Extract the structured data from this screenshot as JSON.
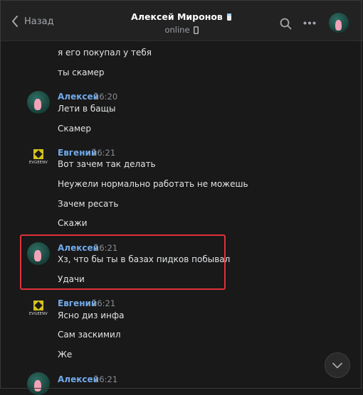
{
  "header": {
    "back_label": "Назад",
    "contact_name": "Алексей Миронов",
    "status": "online"
  },
  "messages": [
    {
      "text": "я его покупал у тебя"
    },
    {
      "text": "ты скамер"
    },
    {
      "author": "Алексей",
      "time": "16:20",
      "text": "Лети в бащы"
    },
    {
      "text": "Скамер"
    },
    {
      "author": "Евгений",
      "time": "16:21",
      "text": "Вот зачем так делать"
    },
    {
      "text": "Неужели нормально работать не можешь"
    },
    {
      "text": "Зачем ресать"
    },
    {
      "text": "Скажи"
    },
    {
      "author": "Алексей",
      "time": "16:21",
      "text": "Хз, что бы ты в базах пидков побывал"
    },
    {
      "text": "Удачи"
    },
    {
      "author": "Евгений",
      "time": "16:21",
      "text": "Ясно диз инфа"
    },
    {
      "text": "Сам заскимил"
    },
    {
      "text": "Же"
    },
    {
      "author": "Алексей",
      "time": "16:21"
    }
  ],
  "avatars": {
    "evgeny_logo_text": "EVGEENV"
  },
  "colors": {
    "accent_name": "#71aaeb",
    "highlight": "#e0303b",
    "background": "#191919"
  }
}
